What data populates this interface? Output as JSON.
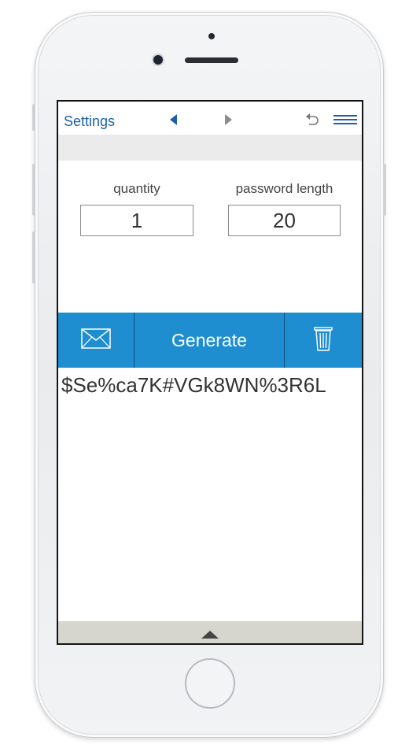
{
  "toolbar": {
    "settings_label": "Settings",
    "icons": [
      "triangle-left-icon",
      "triangle-right-icon",
      "undo-icon",
      "menu-icon"
    ]
  },
  "form": {
    "quantity_label": "quantity",
    "quantity_value": "1",
    "length_label": "password length",
    "length_value": "20"
  },
  "actions": {
    "email_icon": "envelope-icon",
    "generate_label": "Generate",
    "delete_icon": "trash-icon"
  },
  "output": {
    "password": "$Se%ca7K#VGk8WN%3R6L"
  },
  "footer": {
    "expand_icon": "triangle-up-icon"
  },
  "colors": {
    "accent": "#1e8ed1",
    "link": "#1f5fa8",
    "banner": "#ebebeb",
    "footer": "#d6d6cf"
  }
}
